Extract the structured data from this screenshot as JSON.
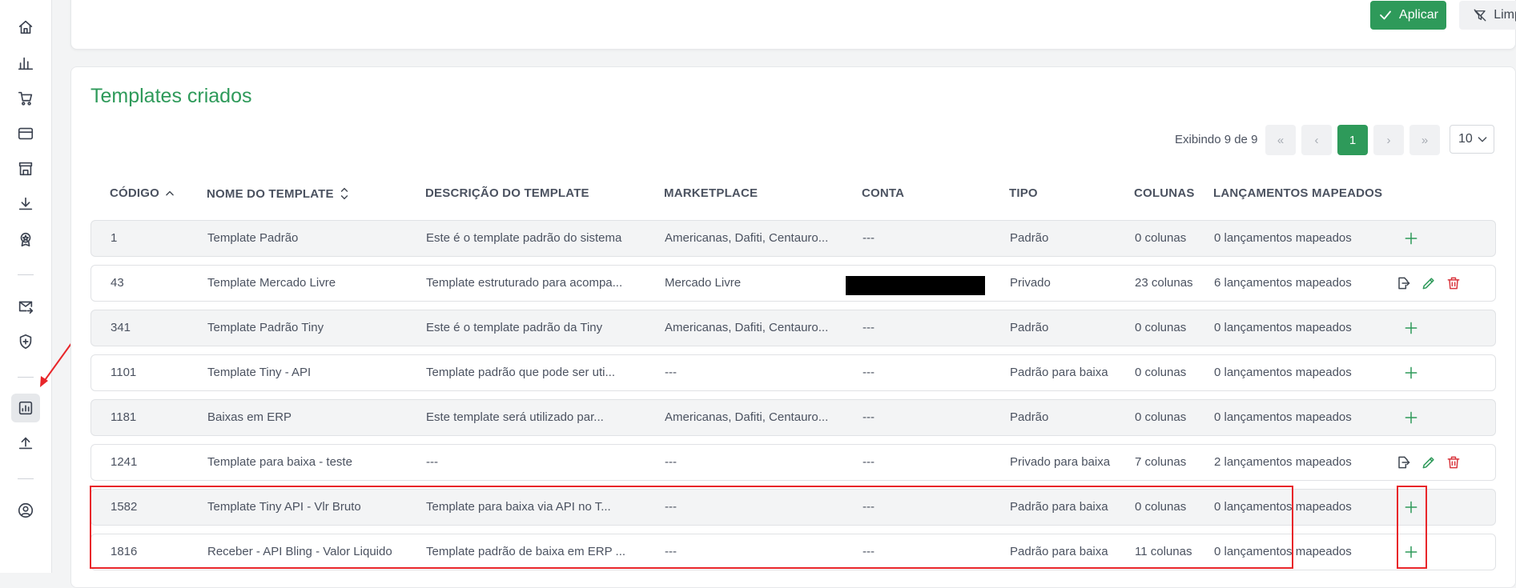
{
  "sidebar": {
    "items": [
      {
        "icon": "home-icon"
      },
      {
        "icon": "bar-chart-icon"
      },
      {
        "icon": "cart-icon"
      },
      {
        "icon": "credit-card-icon"
      },
      {
        "icon": "store-icon"
      },
      {
        "icon": "download-icon"
      },
      {
        "icon": "award-icon"
      },
      {
        "icon": "mail-forward-icon"
      },
      {
        "icon": "shield-plus-icon"
      },
      {
        "icon": "report-chart-icon",
        "active": true
      },
      {
        "icon": "upload-icon"
      },
      {
        "icon": "user-circle-icon"
      }
    ]
  },
  "filters": {
    "apply_label": "Aplicar",
    "clear_label": "Limpar filtros"
  },
  "templates": {
    "title": "Templates criados",
    "pagination": {
      "info": "Exibindo 9 de 9",
      "current_page": "1",
      "page_size": "10"
    },
    "columns": {
      "code": "CÓDIGO",
      "name": "NOME DO TEMPLATE",
      "description": "DESCRIÇÃO DO TEMPLATE",
      "marketplace": "MARKETPLACE",
      "account": "CONTA",
      "type": "TIPO",
      "columns": "COLUNAS",
      "entries": "LANÇAMENTOS MAPEADOS"
    },
    "rows": [
      {
        "code": "1",
        "name": "Template Padrão",
        "description": "Este é o template padrão do sistema",
        "marketplace": "Americanas, Dafiti, Centauro...",
        "account": "---",
        "type": "Padrão",
        "columns": "0 colunas",
        "entries": "0 lançamentos mapeados",
        "actions": "add"
      },
      {
        "code": "43",
        "name": "Template Mercado Livre",
        "description": "Template estruturado para acompa...",
        "marketplace": "Mercado Livre",
        "account": "",
        "type": "Privado",
        "columns": "23 colunas",
        "entries": "6 lançamentos mapeados",
        "actions": "edit"
      },
      {
        "code": "341",
        "name": "Template Padrão Tiny",
        "description": "Este é o template padrão da Tiny",
        "marketplace": "Americanas, Dafiti, Centauro...",
        "account": "---",
        "type": "Padrão",
        "columns": "0 colunas",
        "entries": "0 lançamentos mapeados",
        "actions": "add"
      },
      {
        "code": "1101",
        "name": "Template Tiny - API",
        "description": "Template padrão que pode ser uti...",
        "marketplace": "---",
        "account": "---",
        "type": "Padrão para baixa",
        "columns": "0 colunas",
        "entries": "0 lançamentos mapeados",
        "actions": "add"
      },
      {
        "code": "1181",
        "name": "Baixas em ERP",
        "description": "Este template será utilizado par...",
        "marketplace": "Americanas, Dafiti, Centauro...",
        "account": "---",
        "type": "Padrão",
        "columns": "0 colunas",
        "entries": "0 lançamentos mapeados",
        "actions": "add"
      },
      {
        "code": "1241",
        "name": "Template para baixa - teste",
        "description": "---",
        "marketplace": "---",
        "account": "---",
        "type": "Privado para baixa",
        "columns": "7 colunas",
        "entries": "2 lançamentos mapeados",
        "actions": "edit"
      },
      {
        "code": "1582",
        "name": "Template Tiny API - Vlr Bruto",
        "description": "Template para baixa via API no T...",
        "marketplace": "---",
        "account": "---",
        "type": "Padrão para baixa",
        "columns": "0 colunas",
        "entries": "0 lançamentos mapeados",
        "actions": "add"
      },
      {
        "code": "1816",
        "name": "Receber - API Bling - Valor Liquido",
        "description": "Template padrão de baixa em ERP ...",
        "marketplace": "---",
        "account": "---",
        "type": "Padrão para baixa",
        "columns": "11 colunas",
        "entries": "0 lançamentos mapeados",
        "actions": "add"
      }
    ]
  },
  "colors": {
    "accent": "#2e9a5a",
    "delete": "#d9363e",
    "highlight": "#e8262a"
  }
}
